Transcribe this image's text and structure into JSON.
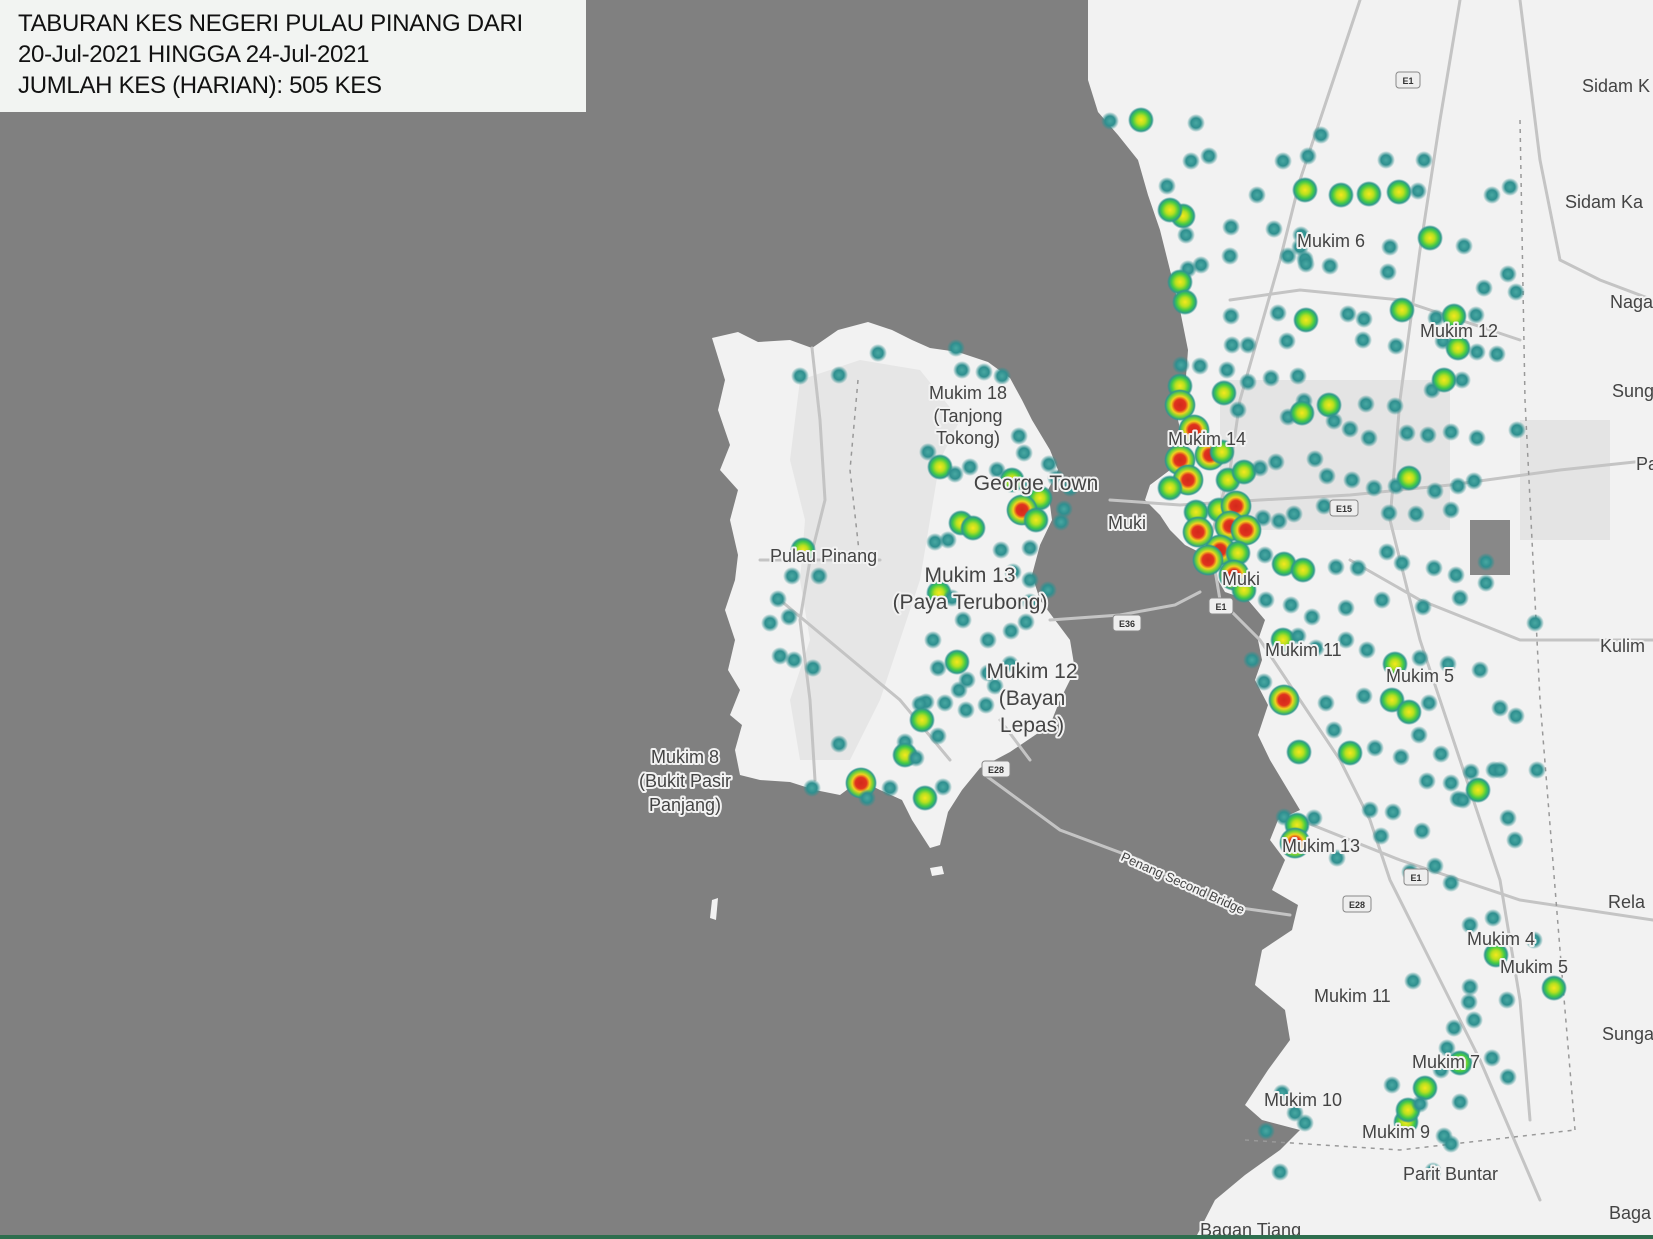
{
  "title": {
    "line1": "TABURAN KES NEGERI PULAU PINANG DARI",
    "line2": "20-Jul-2021 HINGGA 24-Jul-2021",
    "line3": "JUMLAH KES (HARIAN): 505 KES"
  },
  "colors": {
    "sea": "#808080",
    "land": "#f2f2f2",
    "heat_low": "#2f8f8f",
    "heat_mid": "#b8e01e",
    "heat_high": "#e0321e"
  },
  "place_labels": [
    "Sidam K",
    "Sidam Ka",
    "Naga",
    "Sung Selu",
    "Pa",
    "Kulim",
    "Rela",
    "Sunga Kechi",
    "Baga",
    "Mukim 6",
    "Mukim 12",
    "Mukim 14",
    "Muki",
    "Muki",
    "Mukim 11",
    "Mukim 5",
    "Mukim 13",
    "Mukim 4",
    "Mukim 5",
    "Mukim 11",
    "Mukim 7",
    "Mukim 10",
    "Mukim 9",
    "Parit Buntar",
    "Bagan Tiang",
    "Mukim 18",
    "(Tanjong",
    "Tokong)",
    "George Town",
    "Pulau Pinang",
    "Mukim 13",
    "(Paya Terubong)",
    "Mukim 12",
    "(Bayan",
    "Lepas)",
    "Mukim 8",
    "(Bukit Pasir",
    "Panjang)",
    "Penang Second Bridge"
  ],
  "road_shields": [
    "E1",
    "E15",
    "E36",
    "E28",
    "E1",
    "E1",
    "E28"
  ]
}
